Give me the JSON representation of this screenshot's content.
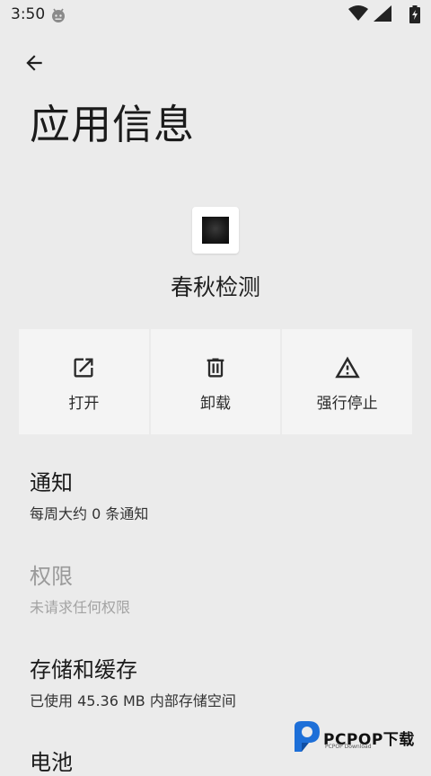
{
  "status_bar": {
    "time": "3:50",
    "icons": [
      "android-debug-icon",
      "wifi-icon",
      "signal-icon",
      "battery-charging-icon"
    ]
  },
  "header": {
    "back_icon": "arrow-left-icon",
    "title": "应用信息"
  },
  "app": {
    "name": "春秋检测",
    "icon": "app-icon-dark"
  },
  "actions": [
    {
      "label": "打开",
      "icon": "open-external-icon"
    },
    {
      "label": "卸载",
      "icon": "trash-icon"
    },
    {
      "label": "强行停止",
      "icon": "warning-triangle-icon"
    }
  ],
  "preferences": [
    {
      "title": "通知",
      "summary": "每周大约 0 条通知",
      "enabled": true
    },
    {
      "title": "权限",
      "summary": "未请求任何权限",
      "enabled": false
    },
    {
      "title": "存储和缓存",
      "summary": "已使用 45.36 MB 内部存储空间",
      "enabled": true
    },
    {
      "title": "电池",
      "summary": "",
      "enabled": true
    }
  ],
  "watermark": {
    "text": "PCPOP下载",
    "subtext": "PCPOP Download"
  },
  "colors": {
    "background": "#ebebeb",
    "action_background": "#f4f4f4",
    "text_primary": "#1b1b1b",
    "text_disabled": "#9a9a9a",
    "watermark_blue": "#1d6fd8"
  }
}
